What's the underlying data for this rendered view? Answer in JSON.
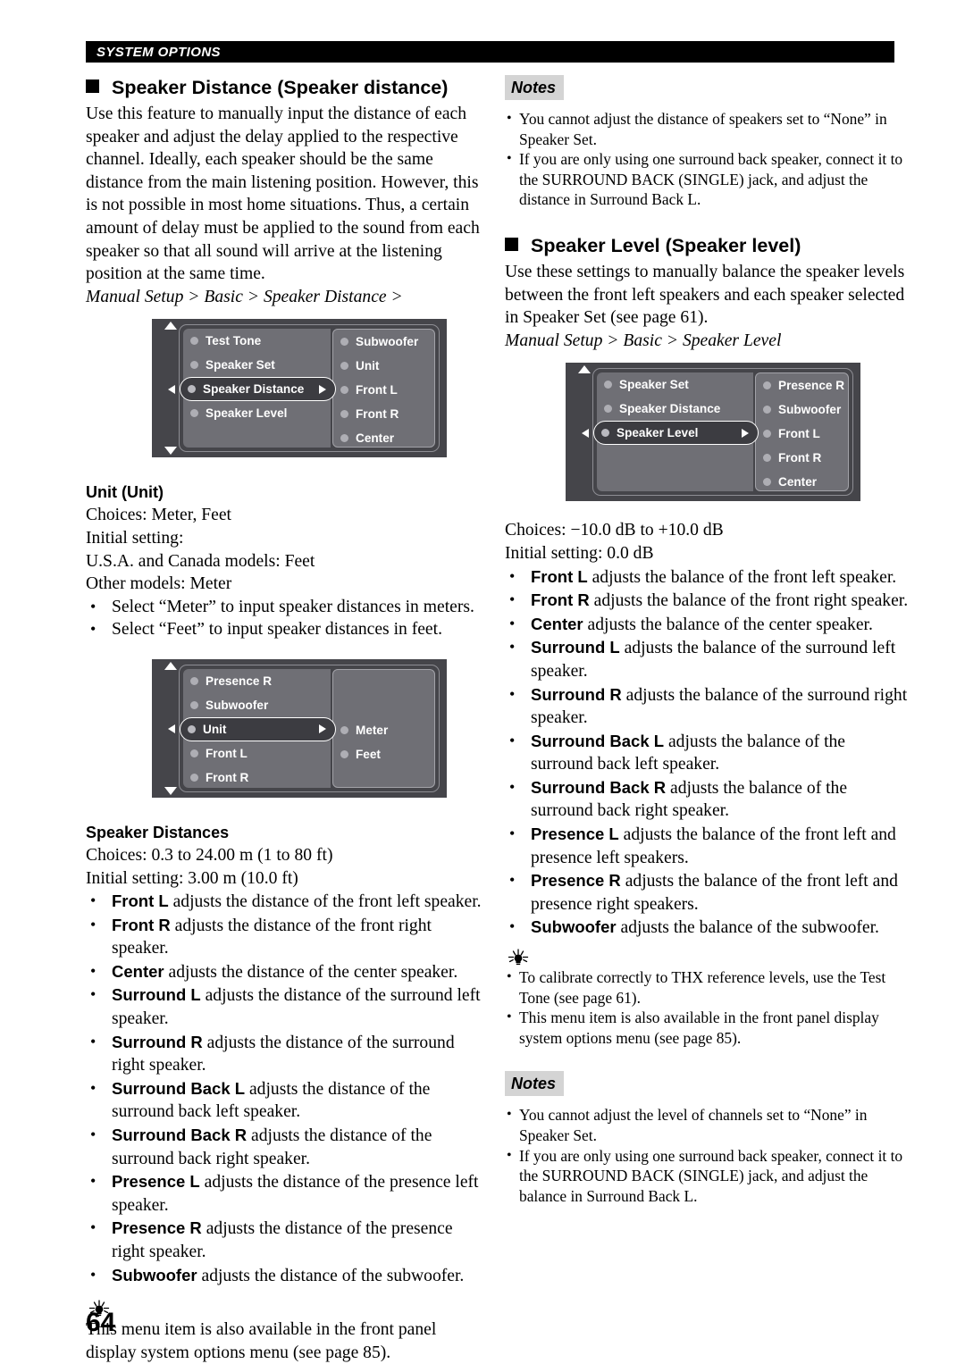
{
  "running_head": "SYSTEM OPTIONS",
  "page_number": "64",
  "left_column": {
    "heading": "Speaker Distance (Speaker distance)",
    "intro": "Use this feature to manually input the distance of each speaker and adjust the delay applied to the respective channel. Ideally, each speaker should be the same distance from the main listening position. However, this is not possible in most home situations. Thus, a certain amount of delay must be applied to the sound from each speaker so that all sound will arrive at the listening position at the same time.",
    "path": "Manual Setup > Basic > Speaker Distance >",
    "menu1": {
      "left_items": [
        "Test Tone",
        "Speaker Set"
      ],
      "selected": "Speaker Distance",
      "left_items_after": [
        "Speaker Level"
      ],
      "right_items": [
        "Subwoofer",
        "Unit",
        "Front L",
        "Front R",
        "Center"
      ]
    },
    "unit_section": {
      "title": "Unit (Unit)",
      "choices": "Choices: Meter, Feet",
      "initial_label": "Initial setting:",
      "initial_usa": "U.S.A. and Canada models: Feet",
      "initial_other": "Other models: Meter",
      "bullets": [
        "Select “Meter” to input speaker distances in meters.",
        "Select “Feet” to input speaker distances in feet."
      ]
    },
    "menu2": {
      "left_items": [
        "Presence R",
        "Subwoofer"
      ],
      "selected": "Unit",
      "left_items_after": [
        "Front L",
        "Front R"
      ],
      "right_items": [
        "Meter",
        "Feet"
      ]
    },
    "distances_section": {
      "title": "Speaker Distances",
      "choices": "Choices: 0.3 to 24.00 m (1 to 80 ft)",
      "initial": "Initial setting: 3.00 m (10.0 ft)",
      "bullets": [
        {
          "term": "Front L",
          "text": " adjusts the distance of the front left speaker."
        },
        {
          "term": "Front R",
          "text": " adjusts the distance of the front right speaker."
        },
        {
          "term": "Center",
          "text": " adjusts the distance of the center speaker."
        },
        {
          "term": "Surround L",
          "text": " adjusts the distance of the surround left speaker."
        },
        {
          "term": "Surround R",
          "text": " adjusts the distance of the surround right speaker."
        },
        {
          "term": "Surround Back L",
          "text": " adjusts the distance of the surround back left speaker."
        },
        {
          "term": "Surround Back R",
          "text": " adjusts the distance of the surround back right speaker."
        },
        {
          "term": "Presence L",
          "text": " adjusts the distance of the presence left speaker."
        },
        {
          "term": "Presence R",
          "text": " adjusts the distance of the presence right speaker."
        },
        {
          "term": "Subwoofer",
          "text": " adjusts the distance of the subwoofer."
        }
      ]
    },
    "tip": "This menu item is also available in the front panel display system options menu (see page 85)."
  },
  "right_column": {
    "notes_top": {
      "label": "Notes",
      "items": [
        "You cannot adjust the distance of speakers set to “None” in Speaker Set.",
        "If you are only using one surround back speaker, connect it to the SURROUND BACK (SINGLE) jack, and adjust the distance in Surround Back L."
      ]
    },
    "heading": "Speaker Level (Speaker level)",
    "intro": "Use these settings to manually balance the speaker levels between the front left speakers and each speaker selected in Speaker Set (see page 61).",
    "path": "Manual Setup > Basic > Speaker Level",
    "menu3": {
      "left_items": [
        "Speaker Set",
        "Speaker Distance"
      ],
      "selected": "Speaker Level",
      "left_items_after": [],
      "right_items": [
        "Presence R",
        "Subwoofer",
        "Front L",
        "Front R",
        "Center"
      ]
    },
    "choices": "Choices: −10.0 dB to +10.0 dB",
    "initial": "Initial setting: 0.0 dB",
    "bullets": [
      {
        "term": "Front L",
        "text": " adjusts the balance of the front left speaker."
      },
      {
        "term": "Front R",
        "text": " adjusts the balance of the front right speaker."
      },
      {
        "term": "Center",
        "text": " adjusts the balance of the center speaker."
      },
      {
        "term": "Surround L",
        "text": " adjusts the balance of the surround left speaker."
      },
      {
        "term": "Surround R",
        "text": " adjusts the balance of the surround right speaker."
      },
      {
        "term": "Surround Back L",
        "text": " adjusts the balance of the surround back left speaker."
      },
      {
        "term": "Surround Back R",
        "text": " adjusts the balance of the surround back right speaker."
      },
      {
        "term": "Presence L",
        "text": " adjusts the balance of the front left and presence left speakers."
      },
      {
        "term": "Presence R",
        "text": " adjusts the balance of the front left and presence right speakers."
      },
      {
        "term": "Subwoofer",
        "text": " adjusts the balance of the subwoofer."
      }
    ],
    "tips": [
      "To calibrate correctly to THX reference levels, use the Test Tone (see page 61).",
      "This menu item is also available in the front panel display system options menu (see page 85)."
    ],
    "notes_bottom": {
      "label": "Notes",
      "items": [
        "You cannot adjust the level of channels set to “None” in Speaker Set.",
        "If you are only using one surround back speaker, connect it to the SURROUND BACK (SINGLE) jack, and adjust the balance in Surround Back L."
      ]
    }
  }
}
